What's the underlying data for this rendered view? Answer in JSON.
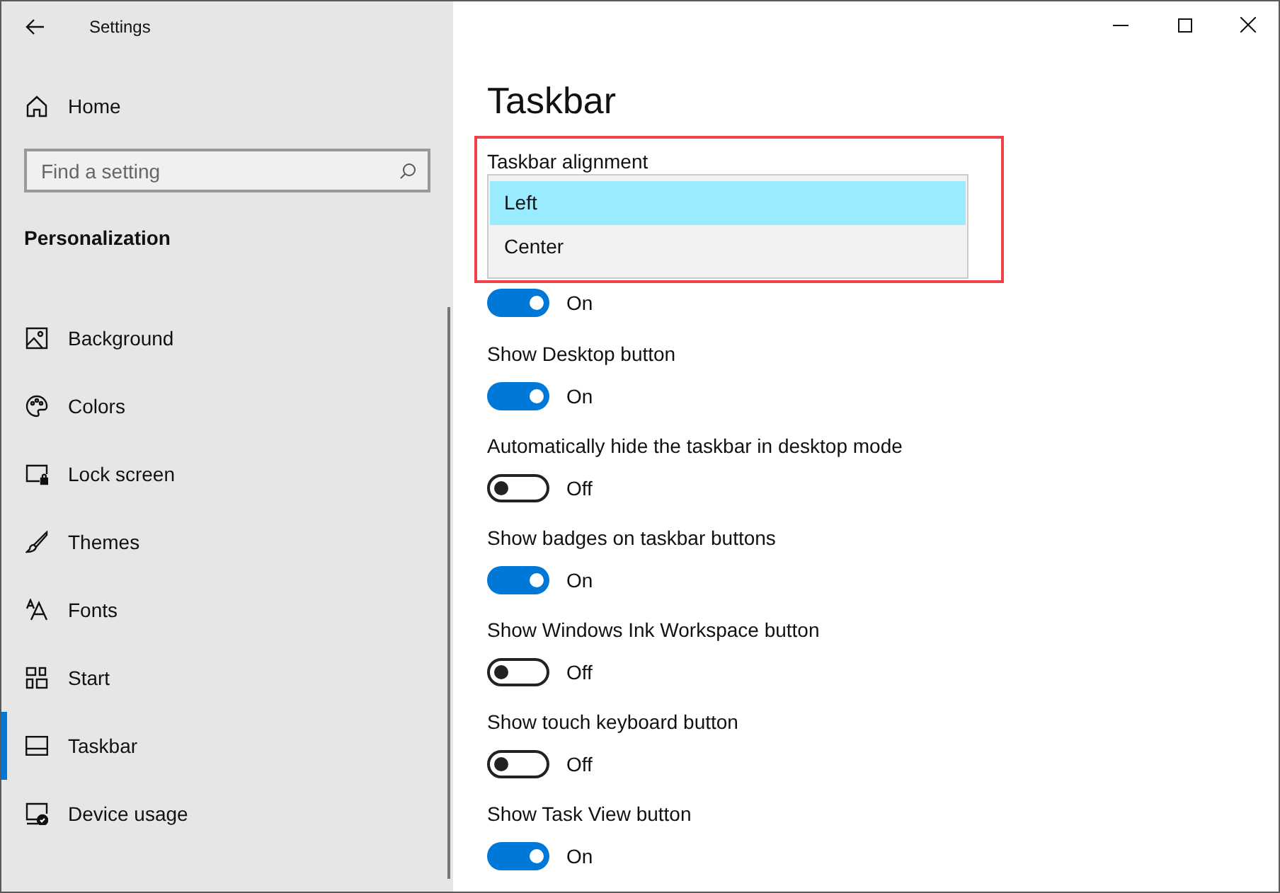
{
  "window": {
    "title": "Settings"
  },
  "sidebar": {
    "home": "Home",
    "search": {
      "placeholder": "Find a setting"
    },
    "section": "Personalization",
    "items": [
      {
        "label": "Background",
        "kind": "picture",
        "selected": false
      },
      {
        "label": "Colors",
        "kind": "palette",
        "selected": false
      },
      {
        "label": "Lock screen",
        "kind": "lock",
        "selected": false
      },
      {
        "label": "Themes",
        "kind": "brush",
        "selected": false
      },
      {
        "label": "Fonts",
        "kind": "fonts",
        "selected": false
      },
      {
        "label": "Start",
        "kind": "start",
        "selected": false
      },
      {
        "label": "Taskbar",
        "kind": "taskbar",
        "selected": true
      },
      {
        "label": "Device usage",
        "kind": "device",
        "selected": false
      }
    ]
  },
  "main": {
    "title": "Taskbar",
    "dropdown": {
      "label": "Taskbar alignment",
      "options": [
        {
          "label": "Left",
          "selected": true
        },
        {
          "label": "Center",
          "selected": false
        }
      ]
    },
    "toggles": [
      {
        "on": true,
        "state_text": "On"
      },
      {
        "label": "Show Desktop button",
        "on": true,
        "state_text": "On"
      },
      {
        "label": "Automatically hide the taskbar in desktop mode",
        "on": false,
        "state_text": "Off"
      },
      {
        "label": "Show badges on taskbar buttons",
        "on": true,
        "state_text": "On"
      },
      {
        "label": "Show Windows Ink Workspace button",
        "on": false,
        "state_text": "Off"
      },
      {
        "label": "Show touch keyboard button",
        "on": false,
        "state_text": "Off"
      },
      {
        "label": "Show Task View button",
        "on": true,
        "state_text": "On"
      }
    ]
  }
}
